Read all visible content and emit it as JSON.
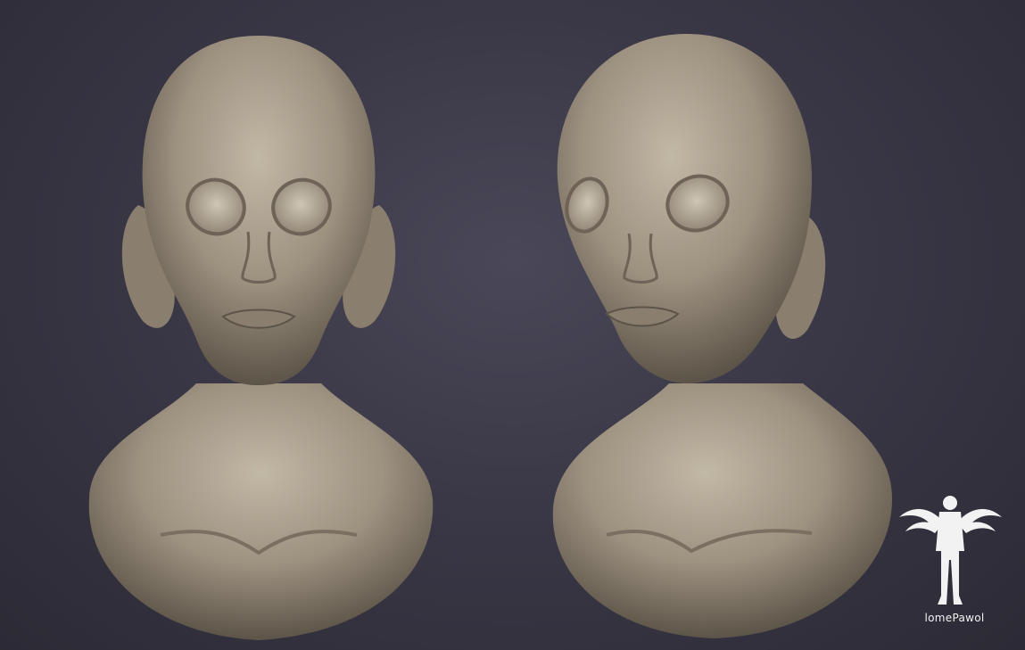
{
  "artwork": {
    "subject": "alien-head-sculpt",
    "views": [
      "front",
      "three-quarter"
    ],
    "background_color": "#35333f",
    "skin_color": "#a89c8a"
  },
  "signature": {
    "text": "lomePawol",
    "color": "#f2f2f2"
  }
}
